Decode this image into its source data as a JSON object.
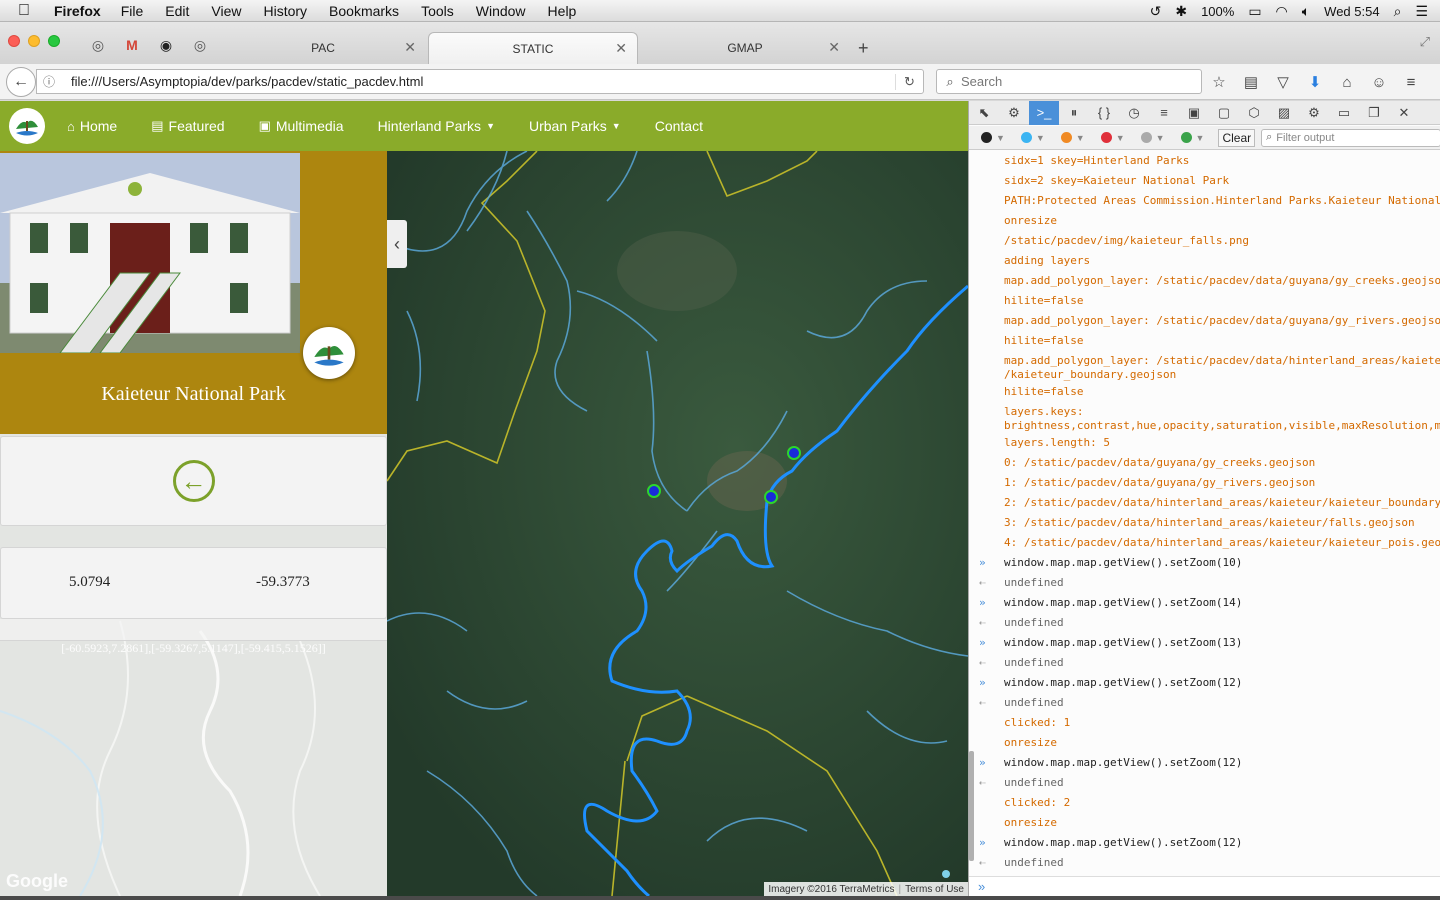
{
  "menubar": {
    "app": "Firefox",
    "items": [
      "File",
      "Edit",
      "View",
      "History",
      "Bookmarks",
      "Tools",
      "Window",
      "Help"
    ],
    "battery": "100%",
    "clock": "Wed 5:54"
  },
  "tabs": [
    {
      "label": "PAC",
      "active": false
    },
    {
      "label": "STATIC",
      "active": true
    },
    {
      "label": "GMAP",
      "active": false
    }
  ],
  "navbar": {
    "url": "file:///Users/Asymptopia/dev/parks/pacdev/static_pacdev.html",
    "search_placeholder": "Search"
  },
  "site": {
    "nav": [
      {
        "label": "Home",
        "icon": "home-icon"
      },
      {
        "label": "Featured",
        "icon": "film-icon"
      },
      {
        "label": "Multimedia",
        "icon": "picture-icon"
      },
      {
        "label": "Hinterland Parks",
        "icon": "caret-down-icon"
      },
      {
        "label": "Urban Parks",
        "icon": "caret-down-icon"
      },
      {
        "label": "Contact",
        "icon": ""
      }
    ],
    "park_title": "Kaieteur National Park",
    "lat": "5.0794",
    "lon": "-59.3773",
    "bbox": "[-60.5923,7.2861],[-59.3267,5.1147],[-59.415,5.1526]]",
    "google_watermark": "Google"
  },
  "map": {
    "attribution": "Imagery ©2016 TerraMetrics",
    "terms": "Terms of Use",
    "colors": {
      "river": "#1e90ff",
      "creek": "#5aa7d8",
      "boundary": "#b9b42a",
      "poi": "#22cc22"
    }
  },
  "devtools": {
    "clear_label": "Clear",
    "filter_placeholder": "Filter output",
    "console": [
      {
        "type": "log",
        "text": "sidx=1 skey=Hinterland Parks"
      },
      {
        "type": "log",
        "text": "sidx=2 skey=Kaieteur National Park"
      },
      {
        "type": "log",
        "text": "PATH:Protected Areas Commission.Hinterland Parks.Kaieteur National"
      },
      {
        "type": "log",
        "text": "onresize"
      },
      {
        "type": "log",
        "text": "/static/pacdev/img/kaieteur_falls.png"
      },
      {
        "type": "log",
        "text": "adding layers"
      },
      {
        "type": "log",
        "text": "map.add_polygon_layer: /static/pacdev/data/guyana/gy_creeks.geojso"
      },
      {
        "type": "log",
        "text": "hilite=false"
      },
      {
        "type": "log",
        "text": "map.add_polygon_layer: /static/pacdev/data/guyana/gy_rivers.geojso"
      },
      {
        "type": "log",
        "text": "hilite=false"
      },
      {
        "type": "log",
        "text": "map.add_polygon_layer: /static/pacdev/data/hinterland_areas/kaiete\n/kaieteur_boundary.geojson"
      },
      {
        "type": "log",
        "text": "hilite=false"
      },
      {
        "type": "log",
        "text": "layers.keys:\nbrightness,contrast,hue,opacity,saturation,visible,maxResolution,m"
      },
      {
        "type": "log",
        "text": "layers.length: 5"
      },
      {
        "type": "log",
        "text": "0: /static/pacdev/data/guyana/gy_creeks.geojson"
      },
      {
        "type": "log",
        "text": "1: /static/pacdev/data/guyana/gy_rivers.geojson"
      },
      {
        "type": "log",
        "text": "2: /static/pacdev/data/hinterland_areas/kaieteur/kaieteur_boundary"
      },
      {
        "type": "log",
        "text": "3: /static/pacdev/data/hinterland_areas/kaieteur/falls.geojson"
      },
      {
        "type": "log",
        "text": "4: /static/pacdev/data/hinterland_areas/kaieteur/kaieteur_pois.geo"
      },
      {
        "type": "in",
        "text": "window.map.map.getView().setZoom(10)"
      },
      {
        "type": "out",
        "text": "undefined"
      },
      {
        "type": "in",
        "text": "window.map.map.getView().setZoom(14)"
      },
      {
        "type": "out",
        "text": "undefined"
      },
      {
        "type": "in",
        "text": "window.map.map.getView().setZoom(13)"
      },
      {
        "type": "out",
        "text": "undefined"
      },
      {
        "type": "in",
        "text": "window.map.map.getView().setZoom(12)"
      },
      {
        "type": "out",
        "text": "undefined"
      },
      {
        "type": "log",
        "text": "clicked: 1"
      },
      {
        "type": "log",
        "text": "onresize"
      },
      {
        "type": "in",
        "text": "window.map.map.getView().setZoom(12)"
      },
      {
        "type": "out",
        "text": "undefined"
      },
      {
        "type": "log",
        "text": "clicked: 2"
      },
      {
        "type": "log",
        "text": "onresize"
      },
      {
        "type": "in",
        "text": "window.map.map.getView().setZoom(12)"
      },
      {
        "type": "out",
        "text": "undefined"
      }
    ]
  }
}
